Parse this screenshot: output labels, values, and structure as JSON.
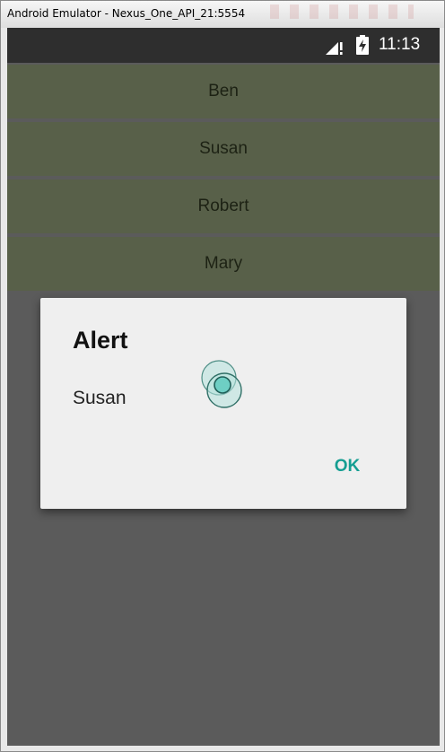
{
  "window": {
    "title": "Android Emulator - Nexus_One_API_21:5554"
  },
  "status_bar": {
    "time": "11:13",
    "icons": [
      "signal-no-data-icon",
      "battery-charging-icon"
    ]
  },
  "list": {
    "items": [
      {
        "label": "Ben"
      },
      {
        "label": "Susan"
      },
      {
        "label": "Robert"
      },
      {
        "label": "Mary"
      }
    ]
  },
  "dialog": {
    "title": "Alert",
    "message": "Susan",
    "ok_label": "OK"
  },
  "colors": {
    "status_bar": "#2e2e2e",
    "list_item_bg": "#586049",
    "scrim": "#5b5b5b",
    "dialog_bg": "#efefef",
    "accent": "#159e92"
  }
}
